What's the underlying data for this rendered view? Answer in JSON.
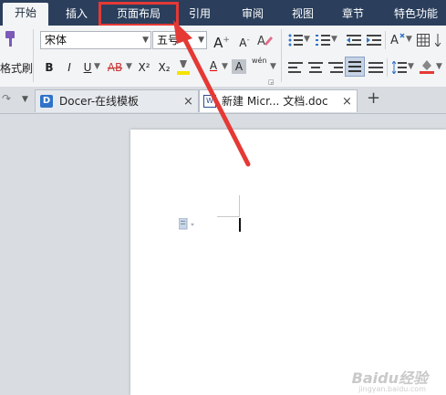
{
  "menubar": {
    "items": [
      {
        "label": "开始"
      },
      {
        "label": "插入"
      },
      {
        "label": "页面布局"
      },
      {
        "label": "引用"
      },
      {
        "label": "审阅"
      },
      {
        "label": "视图"
      },
      {
        "label": "章节"
      },
      {
        "label": "特色功能"
      }
    ]
  },
  "ribbon": {
    "format_painter_label": "格式刷",
    "font_name": "宋体",
    "font_size": "五号",
    "btn_bold": "B",
    "btn_italic": "I",
    "btn_underline": "U",
    "btn_strike": "AB",
    "btn_superscript": "X²",
    "btn_subscript": "X₂",
    "btn_grow": "A",
    "btn_shrink": "A",
    "btn_font_color": "A",
    "btn_char_shading": "A",
    "btn_pinyin": "wén"
  },
  "tabs": [
    {
      "label": "Docer-在线模板"
    },
    {
      "label": "新建 Micr... 文档.doc"
    }
  ],
  "tab_add_label": "+",
  "tab_close_glyph": "×",
  "colors": {
    "menubar_bg": "#2b3f5c",
    "highlight": "#e53935",
    "accent_blue": "#2f73c9"
  },
  "watermark": {
    "text": "Baidu经验",
    "sub": "jingyan.baidu.com"
  }
}
